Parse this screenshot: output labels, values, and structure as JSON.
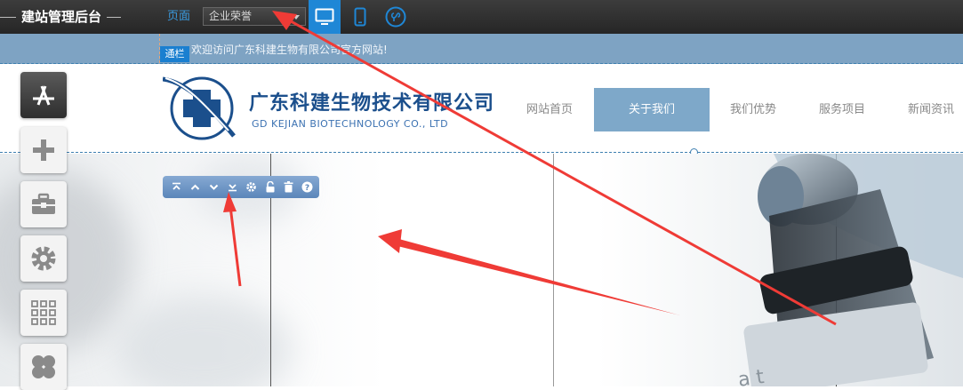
{
  "topbar": {
    "title": "建站管理后台",
    "page_label": "页面",
    "page_select_value": "企业荣誉",
    "devices": [
      "desktop-icon",
      "mobile-icon",
      "mini-program-icon"
    ],
    "accent": "#1f87d6"
  },
  "notice": {
    "text": "欢迎访问广东科建生物有限公司官方网站!",
    "badge": "通栏"
  },
  "header": {
    "company_name": "广东科建生物技术有限公司",
    "company_name_en": "GD KEJIAN BIOTECHNOLOGY CO., LTD",
    "nav": [
      "网站首页",
      "关于我们",
      "我们优势",
      "服务项目",
      "新闻资讯"
    ],
    "active_nav": "关于我们"
  },
  "toolbar": {
    "icons": [
      "move-top-icon",
      "move-up-icon",
      "move-down-icon",
      "move-bottom-icon",
      "settings-icon",
      "unlock-icon",
      "delete-icon",
      "help-icon"
    ]
  },
  "sidebar": {
    "icons": [
      "app-store-icon",
      "add-icon",
      "toolbox-icon",
      "gear-icon",
      "apps-grid-icon",
      "clover-icon"
    ]
  },
  "colors": {
    "notice_bg": "#7ea3c3",
    "nav_active": "#7ea8c9",
    "arrow": "#ef3b36",
    "brand_blue": "#1b4f8c"
  }
}
